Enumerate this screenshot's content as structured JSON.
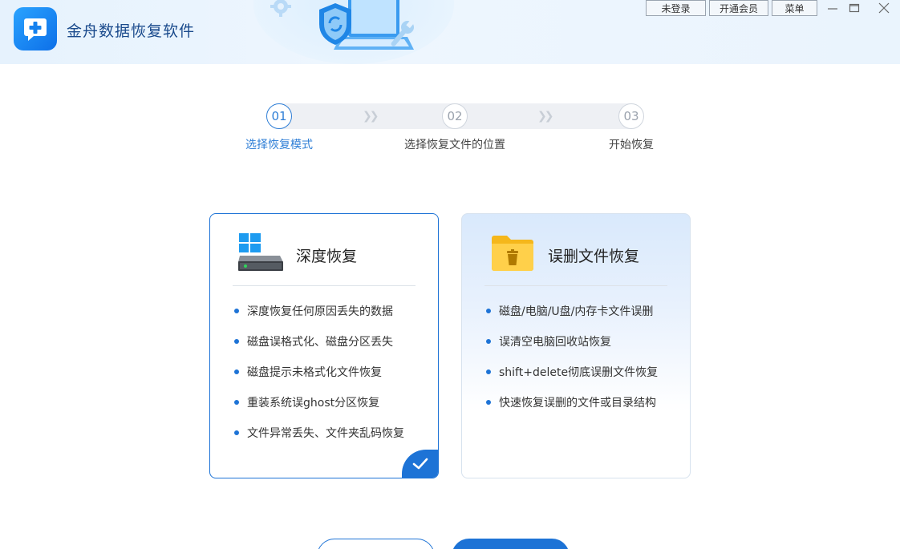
{
  "app": {
    "title": "金舟数据恢复软件"
  },
  "topbar": {
    "login_label": "未登录",
    "vip_label": "开通会员",
    "menu_label": "菜单"
  },
  "steps": [
    {
      "number": "01",
      "label": "选择恢复模式",
      "active": true
    },
    {
      "number": "02",
      "label": "选择恢复文件的位置",
      "active": false
    },
    {
      "number": "03",
      "label": "开始恢复",
      "active": false
    }
  ],
  "cards": {
    "deep": {
      "title": "深度恢复",
      "features": [
        "深度恢复任何原因丢失的数据",
        "磁盘误格式化、磁盘分区丢失",
        "磁盘提示未格式化文件恢复",
        "重装系统误ghost分区恢复",
        "文件异常丢失、文件夹乱码恢复"
      ],
      "selected": true
    },
    "deleted": {
      "title": "误删文件恢复",
      "features": [
        "磁盘/电脑/U盘/内存卡文件误删",
        "误清空电脑回收站恢复",
        "shift+delete彻底误删文件恢复",
        "快速恢复误删的文件或目录结构"
      ],
      "selected": false
    }
  },
  "colors": {
    "accent": "#1d73d6",
    "header_bg": "#e6f2fd",
    "step_active": "#2e7ed6"
  }
}
